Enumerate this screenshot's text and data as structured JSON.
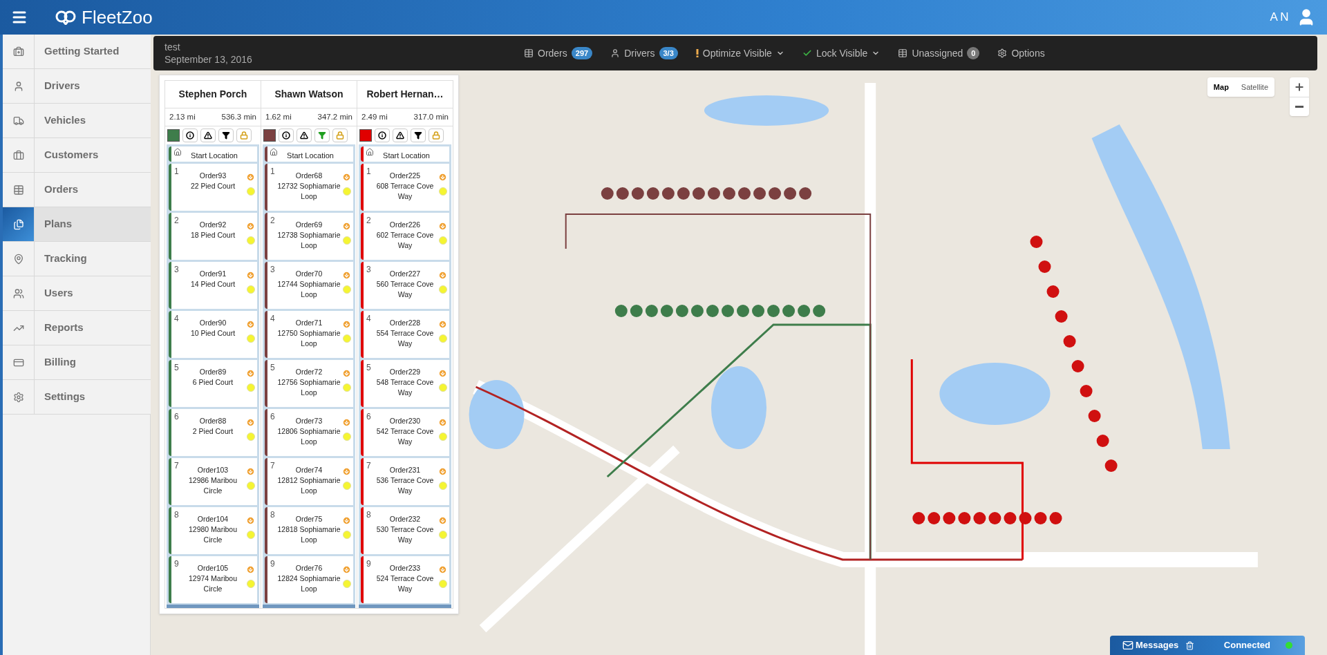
{
  "header": {
    "brand": "FleetZoo",
    "user_initials": "AN"
  },
  "sidebar": {
    "items": [
      {
        "label": "Getting Started",
        "selected": false
      },
      {
        "label": "Drivers",
        "selected": false
      },
      {
        "label": "Vehicles",
        "selected": false
      },
      {
        "label": "Customers",
        "selected": false
      },
      {
        "label": "Orders",
        "selected": false
      },
      {
        "label": "Plans",
        "selected": true
      },
      {
        "label": "Tracking",
        "selected": false
      },
      {
        "label": "Users",
        "selected": false
      },
      {
        "label": "Reports",
        "selected": false
      },
      {
        "label": "Billing",
        "selected": false
      },
      {
        "label": "Settings",
        "selected": false
      }
    ]
  },
  "plan": {
    "title": "test",
    "date": "September 13, 2016"
  },
  "toolbar": [
    {
      "kind": "count",
      "label": "Orders",
      "badge": "297",
      "color": "#3a87c8"
    },
    {
      "kind": "count",
      "label": "Drivers",
      "badge": "3/3",
      "color": "#3a87c8"
    },
    {
      "kind": "menu",
      "label": "Optimize Visible"
    },
    {
      "kind": "menu",
      "label": "Lock Visible"
    },
    {
      "kind": "count",
      "label": "Unassigned",
      "badge": "0",
      "color": "#777777"
    },
    {
      "kind": "button",
      "label": "Options"
    }
  ],
  "map_types": [
    {
      "label": "Map",
      "selected": true
    },
    {
      "label": "Satellite",
      "selected": false
    }
  ],
  "drivers": [
    {
      "name": "Stephen Porch",
      "distance": "2.13 mi",
      "duration": "536.3 min",
      "color": "#3e7d4b",
      "filter_on": false,
      "start": "Start Location",
      "stops": [
        {
          "number": "1",
          "order": "Order93",
          "address": "22 Pied Court"
        },
        {
          "number": "2",
          "order": "Order92",
          "address": "18 Pied Court"
        },
        {
          "number": "3",
          "order": "Order91",
          "address": "14 Pied Court"
        },
        {
          "number": "4",
          "order": "Order90",
          "address": "10 Pied Court"
        },
        {
          "number": "5",
          "order": "Order89",
          "address": "6 Pied Court"
        },
        {
          "number": "6",
          "order": "Order88",
          "address": "2 Pied Court"
        },
        {
          "number": "7",
          "order": "Order103",
          "address": "12986 Maribou Circle"
        },
        {
          "number": "8",
          "order": "Order104",
          "address": "12980 Maribou Circle"
        },
        {
          "number": "9",
          "order": "Order105",
          "address": "12974 Maribou Circle"
        }
      ]
    },
    {
      "name": "Shawn Watson",
      "distance": "1.62 mi",
      "duration": "347.2 min",
      "color": "#7b4040",
      "filter_on": true,
      "start": "Start Location",
      "stops": [
        {
          "number": "1",
          "order": "Order68",
          "address": "12732 Sophiamarie Loop"
        },
        {
          "number": "2",
          "order": "Order69",
          "address": "12738 Sophiamarie Loop"
        },
        {
          "number": "3",
          "order": "Order70",
          "address": "12744 Sophiamarie Loop"
        },
        {
          "number": "4",
          "order": "Order71",
          "address": "12750 Sophiamarie Loop"
        },
        {
          "number": "5",
          "order": "Order72",
          "address": "12756 Sophiamarie Loop"
        },
        {
          "number": "6",
          "order": "Order73",
          "address": "12806 Sophiamarie Loop"
        },
        {
          "number": "7",
          "order": "Order74",
          "address": "12812 Sophiamarie Loop"
        },
        {
          "number": "8",
          "order": "Order75",
          "address": "12818 Sophiamarie Loop"
        },
        {
          "number": "9",
          "order": "Order76",
          "address": "12824 Sophiamarie Loop"
        }
      ]
    },
    {
      "name": "Robert Hernan…",
      "distance": "2.49 mi",
      "duration": "317.0 min",
      "color": "#e00000",
      "filter_on": false,
      "start": "Start Location",
      "stops": [
        {
          "number": "1",
          "order": "Order225",
          "address": "608 Terrace Cove Way"
        },
        {
          "number": "2",
          "order": "Order226",
          "address": "602 Terrace Cove Way"
        },
        {
          "number": "3",
          "order": "Order227",
          "address": "560 Terrace Cove Way"
        },
        {
          "number": "4",
          "order": "Order228",
          "address": "554 Terrace Cove Way"
        },
        {
          "number": "5",
          "order": "Order229",
          "address": "548 Terrace Cove Way"
        },
        {
          "number": "6",
          "order": "Order230",
          "address": "542 Terrace Cove Way"
        },
        {
          "number": "7",
          "order": "Order231",
          "address": "536 Terrace Cove Way"
        },
        {
          "number": "8",
          "order": "Order232",
          "address": "530 Terrace Cove Way"
        },
        {
          "number": "9",
          "order": "Order233",
          "address": "524 Terrace Cove Way"
        }
      ]
    }
  ],
  "messages_bar": {
    "label": "Messages",
    "status": "Connected",
    "connected": true
  }
}
